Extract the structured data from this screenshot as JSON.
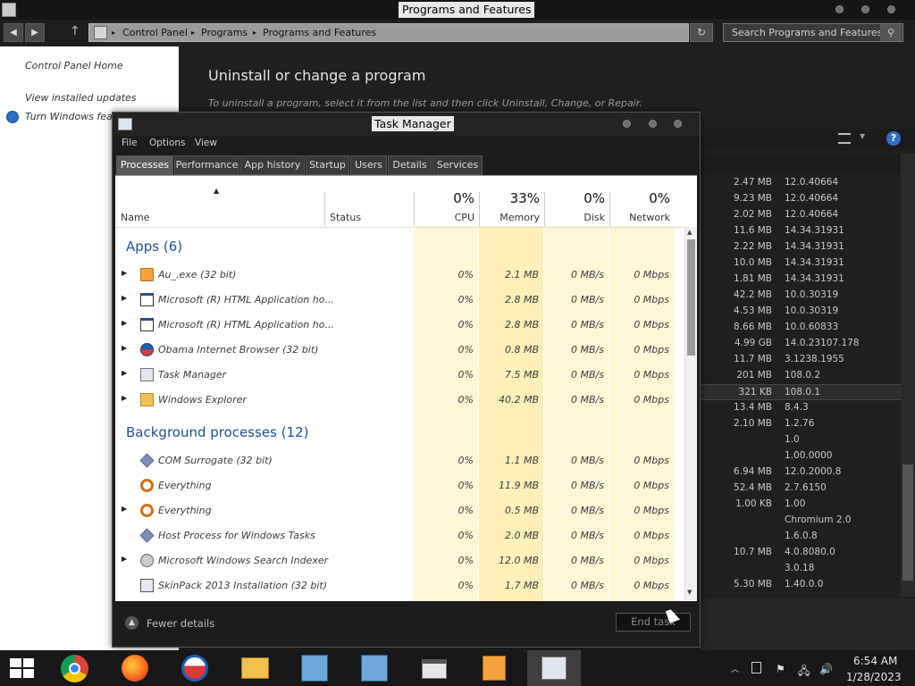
{
  "control_panel": {
    "title": "Programs and Features",
    "breadcrumbs": [
      "Control Panel",
      "Programs",
      "Programs and Features"
    ],
    "search_placeholder": "Search Programs and Features",
    "sidebar": {
      "home": "Control Panel Home",
      "view_updates": "View installed updates",
      "windows_features": "Turn Windows featu"
    },
    "heading": "Uninstall or change a program",
    "subheading": "To uninstall a program, select it from the list and then click Uninstall, Change, or Repair.",
    "visible_rows": [
      {
        "size": "2.47 MB",
        "version": "12.0.40664"
      },
      {
        "size": "9.23 MB",
        "version": "12.0.40664"
      },
      {
        "size": "2.02 MB",
        "version": "12.0.40664"
      },
      {
        "size": "11.6 MB",
        "version": "14.34.31931"
      },
      {
        "size": "2.22 MB",
        "version": "14.34.31931"
      },
      {
        "size": "10.0 MB",
        "version": "14.34.31931"
      },
      {
        "size": "1.81 MB",
        "version": "14.34.31931"
      },
      {
        "size": "42.2 MB",
        "version": "10.0.30319"
      },
      {
        "size": "4.53 MB",
        "version": "10.0.30319"
      },
      {
        "size": "8.66 MB",
        "version": "10.0.60833"
      },
      {
        "size": "4.99 GB",
        "version": "14.0.23107.178"
      },
      {
        "size": "11.7 MB",
        "version": "3.1238.1955"
      },
      {
        "size": "201 MB",
        "version": "108.0.2"
      },
      {
        "size": "321 KB",
        "version": "108.0.1"
      },
      {
        "size": "13.4 MB",
        "version": "8.4.3"
      },
      {
        "size": "2.10 MB",
        "version": "1.2.76"
      },
      {
        "size": "",
        "version": "1.0"
      },
      {
        "size": "",
        "version": "1.00.0000"
      },
      {
        "size": "6.94 MB",
        "version": "12.0.2000.8"
      },
      {
        "size": "52.4 MB",
        "version": "2.7.6150"
      },
      {
        "size": "1.00 KB",
        "version": "1.00"
      },
      {
        "size": "",
        "version": "Chromium 2.0"
      },
      {
        "size": "",
        "version": "1.6.0.8"
      },
      {
        "size": "10.7 MB",
        "version": "4.0.8080.0"
      },
      {
        "size": "",
        "version": "3.0.18"
      },
      {
        "size": "5.30 MB",
        "version": "1.40.0.0"
      }
    ],
    "selected_row_index": 13
  },
  "task_manager": {
    "title": "Task Manager",
    "menu": [
      "File",
      "Options",
      "View"
    ],
    "tabs": [
      "Processes",
      "Performance",
      "App history",
      "Startup",
      "Users",
      "Details",
      "Services"
    ],
    "active_tab": "Processes",
    "columns": {
      "name": "Name",
      "status": "Status",
      "cpu": {
        "pct": "0%",
        "label": "CPU"
      },
      "memory": {
        "pct": "33%",
        "label": "Memory"
      },
      "disk": {
        "pct": "0%",
        "label": "Disk"
      },
      "network": {
        "pct": "0%",
        "label": "Network"
      }
    },
    "apps_section": "Apps (6)",
    "apps": [
      {
        "name": "Au_.exe (32 bit)",
        "icon": "installer-icon",
        "expand": true,
        "cpu": "0%",
        "mem": "2.1 MB",
        "disk": "0 MB/s",
        "net": "0 Mbps"
      },
      {
        "name": "Microsoft (R) HTML Application ho...",
        "icon": "window-icon",
        "expand": true,
        "cpu": "0%",
        "mem": "2.8 MB",
        "disk": "0 MB/s",
        "net": "0 Mbps"
      },
      {
        "name": "Microsoft (R) HTML Application ho...",
        "icon": "window-icon",
        "expand": true,
        "cpu": "0%",
        "mem": "2.8 MB",
        "disk": "0 MB/s",
        "net": "0 Mbps"
      },
      {
        "name": "Obama Internet Browser (32 bit)",
        "icon": "browser-icon",
        "expand": true,
        "cpu": "0%",
        "mem": "0.8 MB",
        "disk": "0 MB/s",
        "net": "0 Mbps"
      },
      {
        "name": "Task Manager",
        "icon": "task-manager-icon",
        "expand": true,
        "cpu": "0%",
        "mem": "7.5 MB",
        "disk": "0 MB/s",
        "net": "0 Mbps"
      },
      {
        "name": "Windows Explorer",
        "icon": "folder-icon",
        "expand": true,
        "cpu": "0%",
        "mem": "40.2 MB",
        "disk": "0 MB/s",
        "net": "0 Mbps"
      }
    ],
    "bg_section": "Background processes (12)",
    "background": [
      {
        "name": "COM Surrogate (32 bit)",
        "icon": "diamond-icon",
        "expand": false,
        "cpu": "0%",
        "mem": "1.1 MB",
        "disk": "0 MB/s",
        "net": "0 Mbps"
      },
      {
        "name": "Everything",
        "icon": "magnifier-icon",
        "expand": false,
        "cpu": "0%",
        "mem": "11.9 MB",
        "disk": "0 MB/s",
        "net": "0 Mbps"
      },
      {
        "name": "Everything",
        "icon": "magnifier-icon",
        "expand": true,
        "cpu": "0%",
        "mem": "0.5 MB",
        "disk": "0 MB/s",
        "net": "0 Mbps"
      },
      {
        "name": "Host Process for Windows Tasks",
        "icon": "diamond-icon",
        "expand": false,
        "cpu": "0%",
        "mem": "2.0 MB",
        "disk": "0 MB/s",
        "net": "0 Mbps"
      },
      {
        "name": "Microsoft Windows Search Indexer",
        "icon": "search-indexer-icon",
        "expand": true,
        "cpu": "0%",
        "mem": "12.0 MB",
        "disk": "0 MB/s",
        "net": "0 Mbps"
      },
      {
        "name": "SkinPack 2013 Installation (32 bit)",
        "icon": "installer-window-icon",
        "expand": false,
        "cpu": "0%",
        "mem": "1.7 MB",
        "disk": "0 MB/s",
        "net": "0 Mbps"
      }
    ],
    "fewer_details": "Fewer details",
    "end_task": "End task"
  },
  "taskbar": {
    "items": [
      "windows-start-icon",
      "chrome-icon",
      "firefox-icon",
      "obama-browser-icon",
      "file-explorer-icon",
      "installer-icon",
      "installer-icon",
      "program-manager-icon",
      "recycle-bin-icon",
      "task-manager-icon"
    ],
    "active_item": "task-manager-icon",
    "time": "6:54 AM",
    "date": "1/28/2023"
  },
  "colors": {
    "section_blue": "#1f4e9c",
    "usage_yellow": "#fff4c4",
    "usage_yellow_strong": "#ffe9a8"
  }
}
